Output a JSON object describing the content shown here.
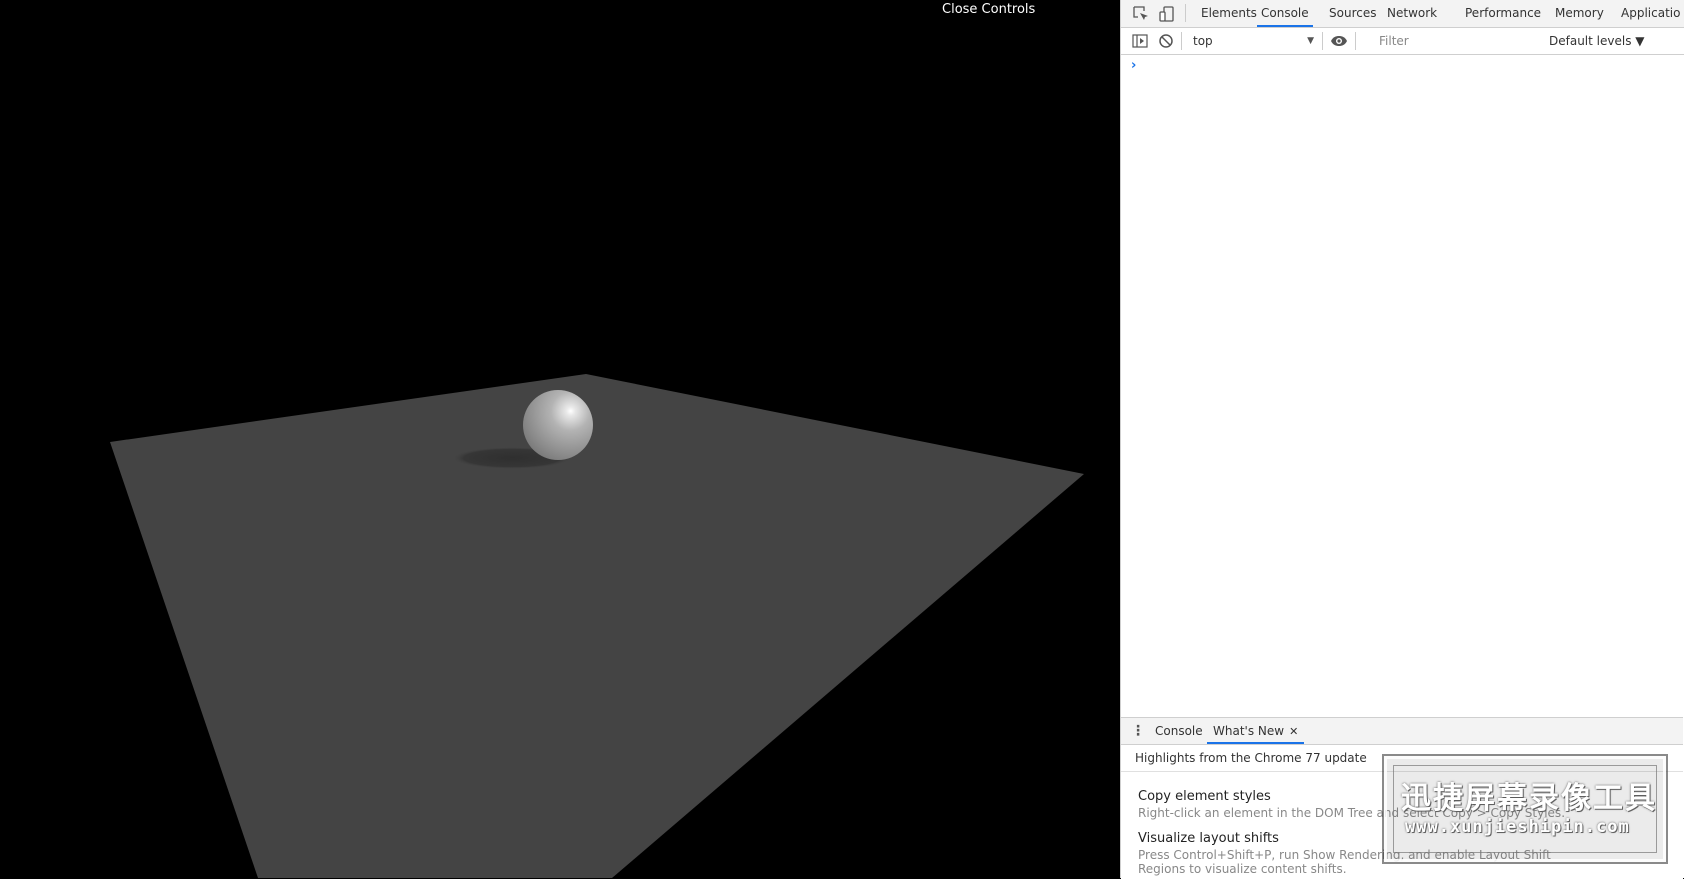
{
  "scene": {
    "close_controls_label": "Close Controls",
    "background_color": "#000000",
    "plane_color": "#444444",
    "sphere_color": "#b8b8b8"
  },
  "devtools": {
    "tabs": [
      {
        "label": "Elements",
        "active": false
      },
      {
        "label": "Console",
        "active": true
      },
      {
        "label": "Sources",
        "active": false
      },
      {
        "label": "Network",
        "active": false
      },
      {
        "label": "Performance",
        "active": false
      },
      {
        "label": "Memory",
        "active": false
      },
      {
        "label": "Applicatio",
        "active": false
      }
    ],
    "toolbar": {
      "context": "top",
      "filter_placeholder": "Filter",
      "levels": "Default levels ▼"
    },
    "console": {
      "prompt": "›"
    },
    "drawer": {
      "tabs": [
        {
          "label": "Console",
          "active": false
        },
        {
          "label": "What's New",
          "active": true
        }
      ],
      "close_glyph": "✕",
      "header": "Highlights from the Chrome 77 update",
      "features": [
        {
          "title": "Copy element styles",
          "desc": "Right-click an element in the DOM Tree and select Copy > Copy Styles."
        },
        {
          "title": "Visualize layout shifts",
          "desc": "Press Control+Shift+P, run Show Rendering, and enable Layout Shift Regions to visualize content shifts."
        }
      ]
    },
    "accent_color": "#1a73e8"
  },
  "watermark": {
    "title": "迅捷屏幕录像工具",
    "url": "www.xunjieshipin.com"
  }
}
